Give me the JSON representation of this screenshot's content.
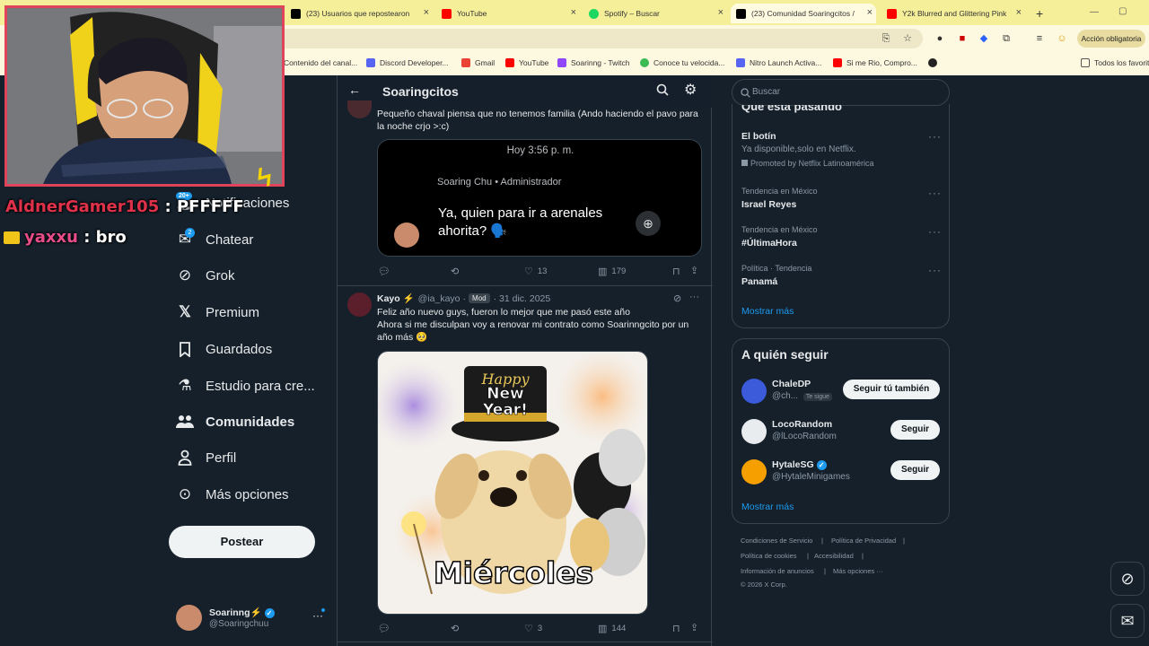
{
  "browser": {
    "tabs": [
      {
        "title": "(23) Usuarios que repostearon",
        "color": "#000000"
      },
      {
        "title": "YouTube",
        "color": "#ff0000"
      },
      {
        "title": "Spotify – Buscar",
        "color": "#1ed760"
      },
      {
        "title": "(23) Comunidad Soaringcitos /",
        "color": "#000000"
      },
      {
        "title": "Y2k Blurred and Glittering Pink",
        "color": "#ff0000"
      }
    ],
    "new_tab": "+",
    "action_button": "Acción obligatoria",
    "bookmarks": [
      {
        "label": "Contenido del canal...",
        "color": "#ff0000"
      },
      {
        "label": "Discord Developer...",
        "color": "#5865f2"
      },
      {
        "label": "Gmail",
        "color": "#ea4335"
      },
      {
        "label": "YouTube",
        "color": "#ff0000"
      },
      {
        "label": "Soarinng - Twitch",
        "color": "#9146ff"
      },
      {
        "label": "Conoce tu velocida...",
        "color": "#3cba54"
      },
      {
        "label": "Nitro Launch Activa...",
        "color": "#5865f2"
      },
      {
        "label": "Si me Rio, Compro...",
        "color": "#ff0000"
      }
    ],
    "all_bookmarks": "Todos los favorit"
  },
  "stream_overlay": {
    "chat": [
      {
        "user": "AldnerGamer105",
        "user_color": "#e0314b",
        "message": "PFFFFF"
      },
      {
        "user": "yaxxu",
        "user_color": "#e84d8a",
        "message": "bro"
      }
    ]
  },
  "sidebar": {
    "badge_notifications": "20+",
    "badge_chat": "2",
    "items": [
      {
        "label": "Notificaciones",
        "icon": "bell-icon",
        "bold": false
      },
      {
        "label": "Chatear",
        "icon": "mail-icon",
        "bold": false
      },
      {
        "label": "Grok",
        "icon": "grok-icon",
        "bold": false
      },
      {
        "label": "Premium",
        "icon": "x-logo-icon",
        "bold": false
      },
      {
        "label": "Guardados",
        "icon": "bookmark-icon",
        "bold": false
      },
      {
        "label": "Estudio para cre...",
        "icon": "flask-icon",
        "bold": false
      },
      {
        "label": "Comunidades",
        "icon": "people-icon",
        "bold": true
      },
      {
        "label": "Perfil",
        "icon": "person-icon",
        "bold": false
      },
      {
        "label": "Más opciones",
        "icon": "more-circle-icon",
        "bold": false
      }
    ],
    "post_button": "Postear",
    "account": {
      "name": "Soarinng⚡",
      "handle": "@Soaringchuu",
      "more": "···"
    }
  },
  "community": {
    "title": "Soaringcitos",
    "post1": {
      "text": "Pequeño chaval piensa que no tenemos familia (Ando haciendo el pavo para la noche crjo >:c)",
      "media": {
        "time": "Hoy 3:56 p. m.",
        "author": "Soaring Chu • Administrador",
        "message": "Ya, quien para ir a arenales ahorita? 🗣️"
      },
      "replies": "",
      "reposts": "",
      "likes": "13",
      "views": "179"
    },
    "post2": {
      "name": "Kayo ⚡",
      "handle": "@ia_kayo",
      "badge": "Mod",
      "date": "· 31 dic. 2025",
      "text": "Feliz año nuevo guys, fueron lo mejor que me pasó este año\nAhora si me disculpan voy a renovar mi contrato como Soarinngcito por un año más 🥺",
      "image_hat_line1": "Happy",
      "image_hat_line2": "New",
      "image_hat_line3": "Year!",
      "image_caption": "Miércoles",
      "replies": "",
      "reposts": "",
      "likes": "3",
      "views": "144"
    }
  },
  "right": {
    "search_placeholder": "Buscar",
    "trends_title": "Qué está pasando",
    "trends": [
      {
        "context": "",
        "name": "El botín",
        "desc": "Ya disponible,solo en Netflix.",
        "promo": "Promoted by Netflix Latinoamérica"
      },
      {
        "context": "Tendencia en México",
        "name": "Israel Reyes"
      },
      {
        "context": "Tendencia en México",
        "name": "#ÚltimaHora"
      },
      {
        "context": "Política · Tendencia",
        "name": "Panamá"
      }
    ],
    "show_more": "Mostrar más",
    "who_to_follow": "A quién seguir",
    "follow": [
      {
        "name": "ChaleDP",
        "handle": "@ch...",
        "tag": "Te sigue",
        "button": "Seguir tú también",
        "avatar_color": "#3b5bdb"
      },
      {
        "name": "LocoRandom",
        "handle": "@lLocoRandom",
        "tag": "",
        "button": "Seguir",
        "avatar_color": "#e9ecef"
      },
      {
        "name": "HytaleSG",
        "handle": "@HytaleMinigames",
        "tag": "",
        "button": "Seguir",
        "avatar_color": "#f59f00"
      }
    ],
    "show_more_2": "Mostrar más",
    "footer": [
      "Condiciones de Servicio",
      "|",
      "Política de Privacidad",
      "|",
      "Política de cookies",
      "|",
      "Accesibilidad",
      "|",
      "Información de anuncios",
      "|",
      "Más opciones ···",
      "© 2026 X Corp."
    ]
  }
}
